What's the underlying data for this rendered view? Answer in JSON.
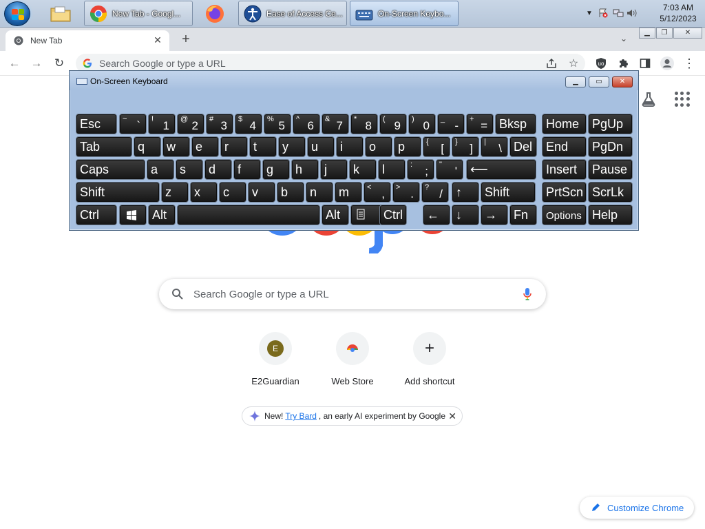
{
  "taskbar": {
    "buttons": [
      {
        "label": "New Tab - Googl..."
      },
      {
        "label": "Ease of Access Ce..."
      },
      {
        "label": "On-Screen Keybo..."
      }
    ],
    "clock": {
      "time": "7:03 AM",
      "date": "5/12/2023"
    }
  },
  "browser": {
    "tab_title": "New Tab",
    "omnibox_placeholder": "Search Google or type a URL"
  },
  "ntp": {
    "search_placeholder": "Search Google or type a URL",
    "shortcuts": [
      {
        "initial": "E",
        "label": "E2Guardian"
      },
      {
        "label": "Web Store"
      },
      {
        "label": "Add shortcut"
      }
    ],
    "bard": {
      "prefix": "New!",
      "link": "Try Bard",
      "suffix": ", an early AI experiment by Google"
    },
    "customize_label": "Customize Chrome"
  },
  "osk": {
    "title": "On-Screen Keyboard",
    "rows": [
      [
        {
          "main": "Esc"
        },
        {
          "sm": "~",
          "bg": "`"
        },
        {
          "sm": "!",
          "bg": "1"
        },
        {
          "sm": "@",
          "bg": "2"
        },
        {
          "sm": "#",
          "bg": "3"
        },
        {
          "sm": "$",
          "bg": "4"
        },
        {
          "sm": "%",
          "bg": "5"
        },
        {
          "sm": "^",
          "bg": "6"
        },
        {
          "sm": "&",
          "bg": "7"
        },
        {
          "sm": "*",
          "bg": "8"
        },
        {
          "sm": "(",
          "bg": "9"
        },
        {
          "sm": ")",
          "bg": "0"
        },
        {
          "sm": "_",
          "bg": "-"
        },
        {
          "sm": "+",
          "bg": "="
        },
        {
          "main": "Bksp"
        },
        {
          "main": "Home"
        },
        {
          "main": "PgUp"
        }
      ],
      [
        {
          "main": "Tab"
        },
        {
          "main": "q"
        },
        {
          "main": "w"
        },
        {
          "main": "e"
        },
        {
          "main": "r"
        },
        {
          "main": "t"
        },
        {
          "main": "y"
        },
        {
          "main": "u"
        },
        {
          "main": "i"
        },
        {
          "main": "o"
        },
        {
          "main": "p"
        },
        {
          "sm": "{",
          "bg": "["
        },
        {
          "sm": "}",
          "bg": "]"
        },
        {
          "sm": "|",
          "bg": "\\"
        },
        {
          "main": "Del"
        },
        {
          "main": "End"
        },
        {
          "main": "PgDn"
        }
      ],
      [
        {
          "main": "Caps"
        },
        {
          "main": "a"
        },
        {
          "main": "s"
        },
        {
          "main": "d"
        },
        {
          "main": "f"
        },
        {
          "main": "g"
        },
        {
          "main": "h"
        },
        {
          "main": "j"
        },
        {
          "main": "k"
        },
        {
          "main": "l"
        },
        {
          "sm": ":",
          "bg": ";"
        },
        {
          "sm": "\"",
          "bg": "'"
        },
        {
          "main": "⟵"
        },
        {
          "main": "Insert"
        },
        {
          "main": "Pause"
        }
      ],
      [
        {
          "main": "Shift"
        },
        {
          "main": "z"
        },
        {
          "main": "x"
        },
        {
          "main": "c"
        },
        {
          "main": "v"
        },
        {
          "main": "b"
        },
        {
          "main": "n"
        },
        {
          "main": "m"
        },
        {
          "sm": "<",
          "bg": ","
        },
        {
          "sm": ">",
          "bg": "."
        },
        {
          "sm": "?",
          "bg": "/"
        },
        {
          "main": "↑"
        },
        {
          "main": "Shift"
        },
        {
          "main": "PrtScn"
        },
        {
          "main": "ScrLk"
        }
      ],
      [
        {
          "main": "Ctrl"
        },
        {
          "icon": "windows-logo"
        },
        {
          "main": "Alt"
        },
        {
          "main": ""
        },
        {
          "main": "Alt"
        },
        {
          "icon": "menu-key"
        },
        {
          "main": "Ctrl"
        },
        {
          "main": "←"
        },
        {
          "main": "↓"
        },
        {
          "main": "→"
        },
        {
          "main": "Fn"
        },
        {
          "main": "Options",
          "small": true
        },
        {
          "main": "Help"
        }
      ]
    ]
  },
  "colors": {
    "osk_frame": "#a7c0e0",
    "key_bg": "#1f1f1f",
    "google_blue": "#4285f4",
    "google_red": "#ea4335",
    "google_yellow": "#fbbc05",
    "google_green": "#34a853",
    "link_blue": "#1a73e8"
  }
}
